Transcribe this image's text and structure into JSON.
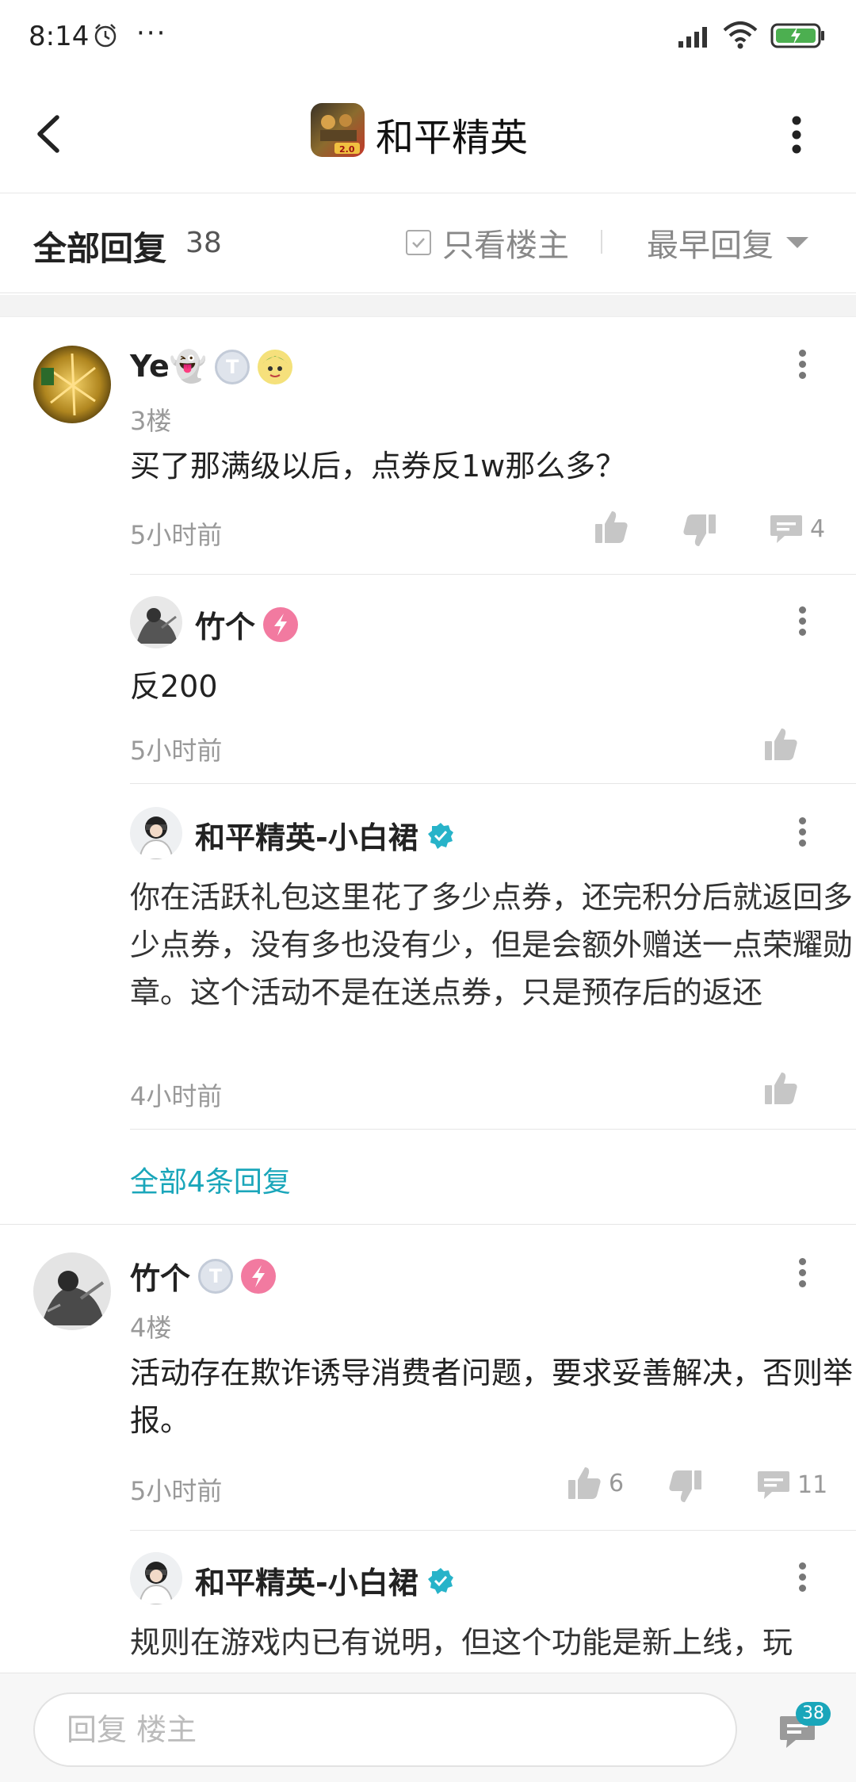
{
  "status_bar": {
    "time": "8:14",
    "dots": "···",
    "battery_level": 1.0
  },
  "header": {
    "title": "和平精英",
    "game_icon_text": "2.0"
  },
  "filter": {
    "all_replies_label": "全部回复",
    "count": "38",
    "only_op_label": "只看楼主",
    "sort_label": "最早回复"
  },
  "comments": [
    {
      "user": "Ye👻",
      "floor": "3楼",
      "text": "买了那满级以后，点券反1w那么多？",
      "time": "5小时前",
      "comment_count": "4",
      "replies": [
        {
          "user": "竹个",
          "text": "反200",
          "time": "5小时前"
        },
        {
          "user": "和平精英-小白裙",
          "text": "你在活跃礼包这里花了多少点券，还完积分后就返回多少点券，没有多也没有少，但是会额外赠送一点荣耀勋章。这个活动不是在送点券，只是预存后的返还",
          "time": "4小时前"
        }
      ],
      "all_replies_link": "全部4条回复"
    },
    {
      "user": "竹个",
      "floor": "4楼",
      "text": "活动存在欺诈诱导消费者问题，要求妥善解决，否则举报。",
      "time": "5小时前",
      "like_count": "6",
      "comment_count": "11",
      "replies": [
        {
          "user": "和平精英-小白裙",
          "text": "规则在游戏内已有说明，但这个功能是新上线，玩"
        }
      ]
    }
  ],
  "bottom": {
    "placeholder": "回复  楼主",
    "comment_badge": "38"
  }
}
